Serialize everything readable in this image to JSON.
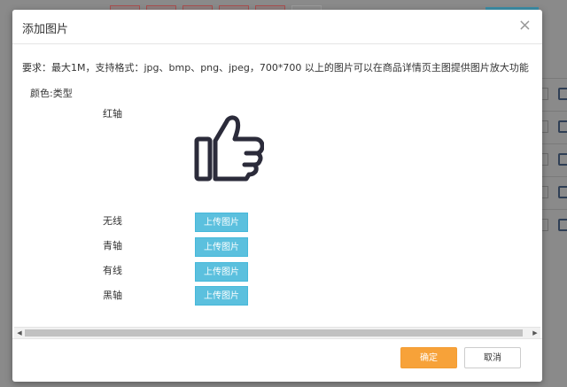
{
  "dialog": {
    "title": "添加图片",
    "close_glyph": "×",
    "requirements": "要求：最大1M，支持格式：jpg、bmp、png、jpeg，700*700 以上的图片可以在商品详情页主图提供图片放大功能"
  },
  "attribute": {
    "label": "颜色:类型",
    "variants": [
      {
        "name": "红轴",
        "has_image": true,
        "image_icon": "thumbs-up-icon"
      },
      {
        "name": "无线",
        "upload_label": "上传图片"
      },
      {
        "name": "青轴",
        "upload_label": "上传图片"
      },
      {
        "name": "有线",
        "upload_label": "上传图片"
      },
      {
        "name": "黑轴",
        "upload_label": "上传图片"
      }
    ]
  },
  "scrollbar": {
    "left_arrow": "◀",
    "right_arrow": "▶"
  },
  "footer": {
    "confirm_label": "确定",
    "cancel_label": "取消"
  },
  "colors": {
    "confirm": "#f7a239",
    "upload": "#5bc0de",
    "overlay": "#7f7f7f"
  }
}
